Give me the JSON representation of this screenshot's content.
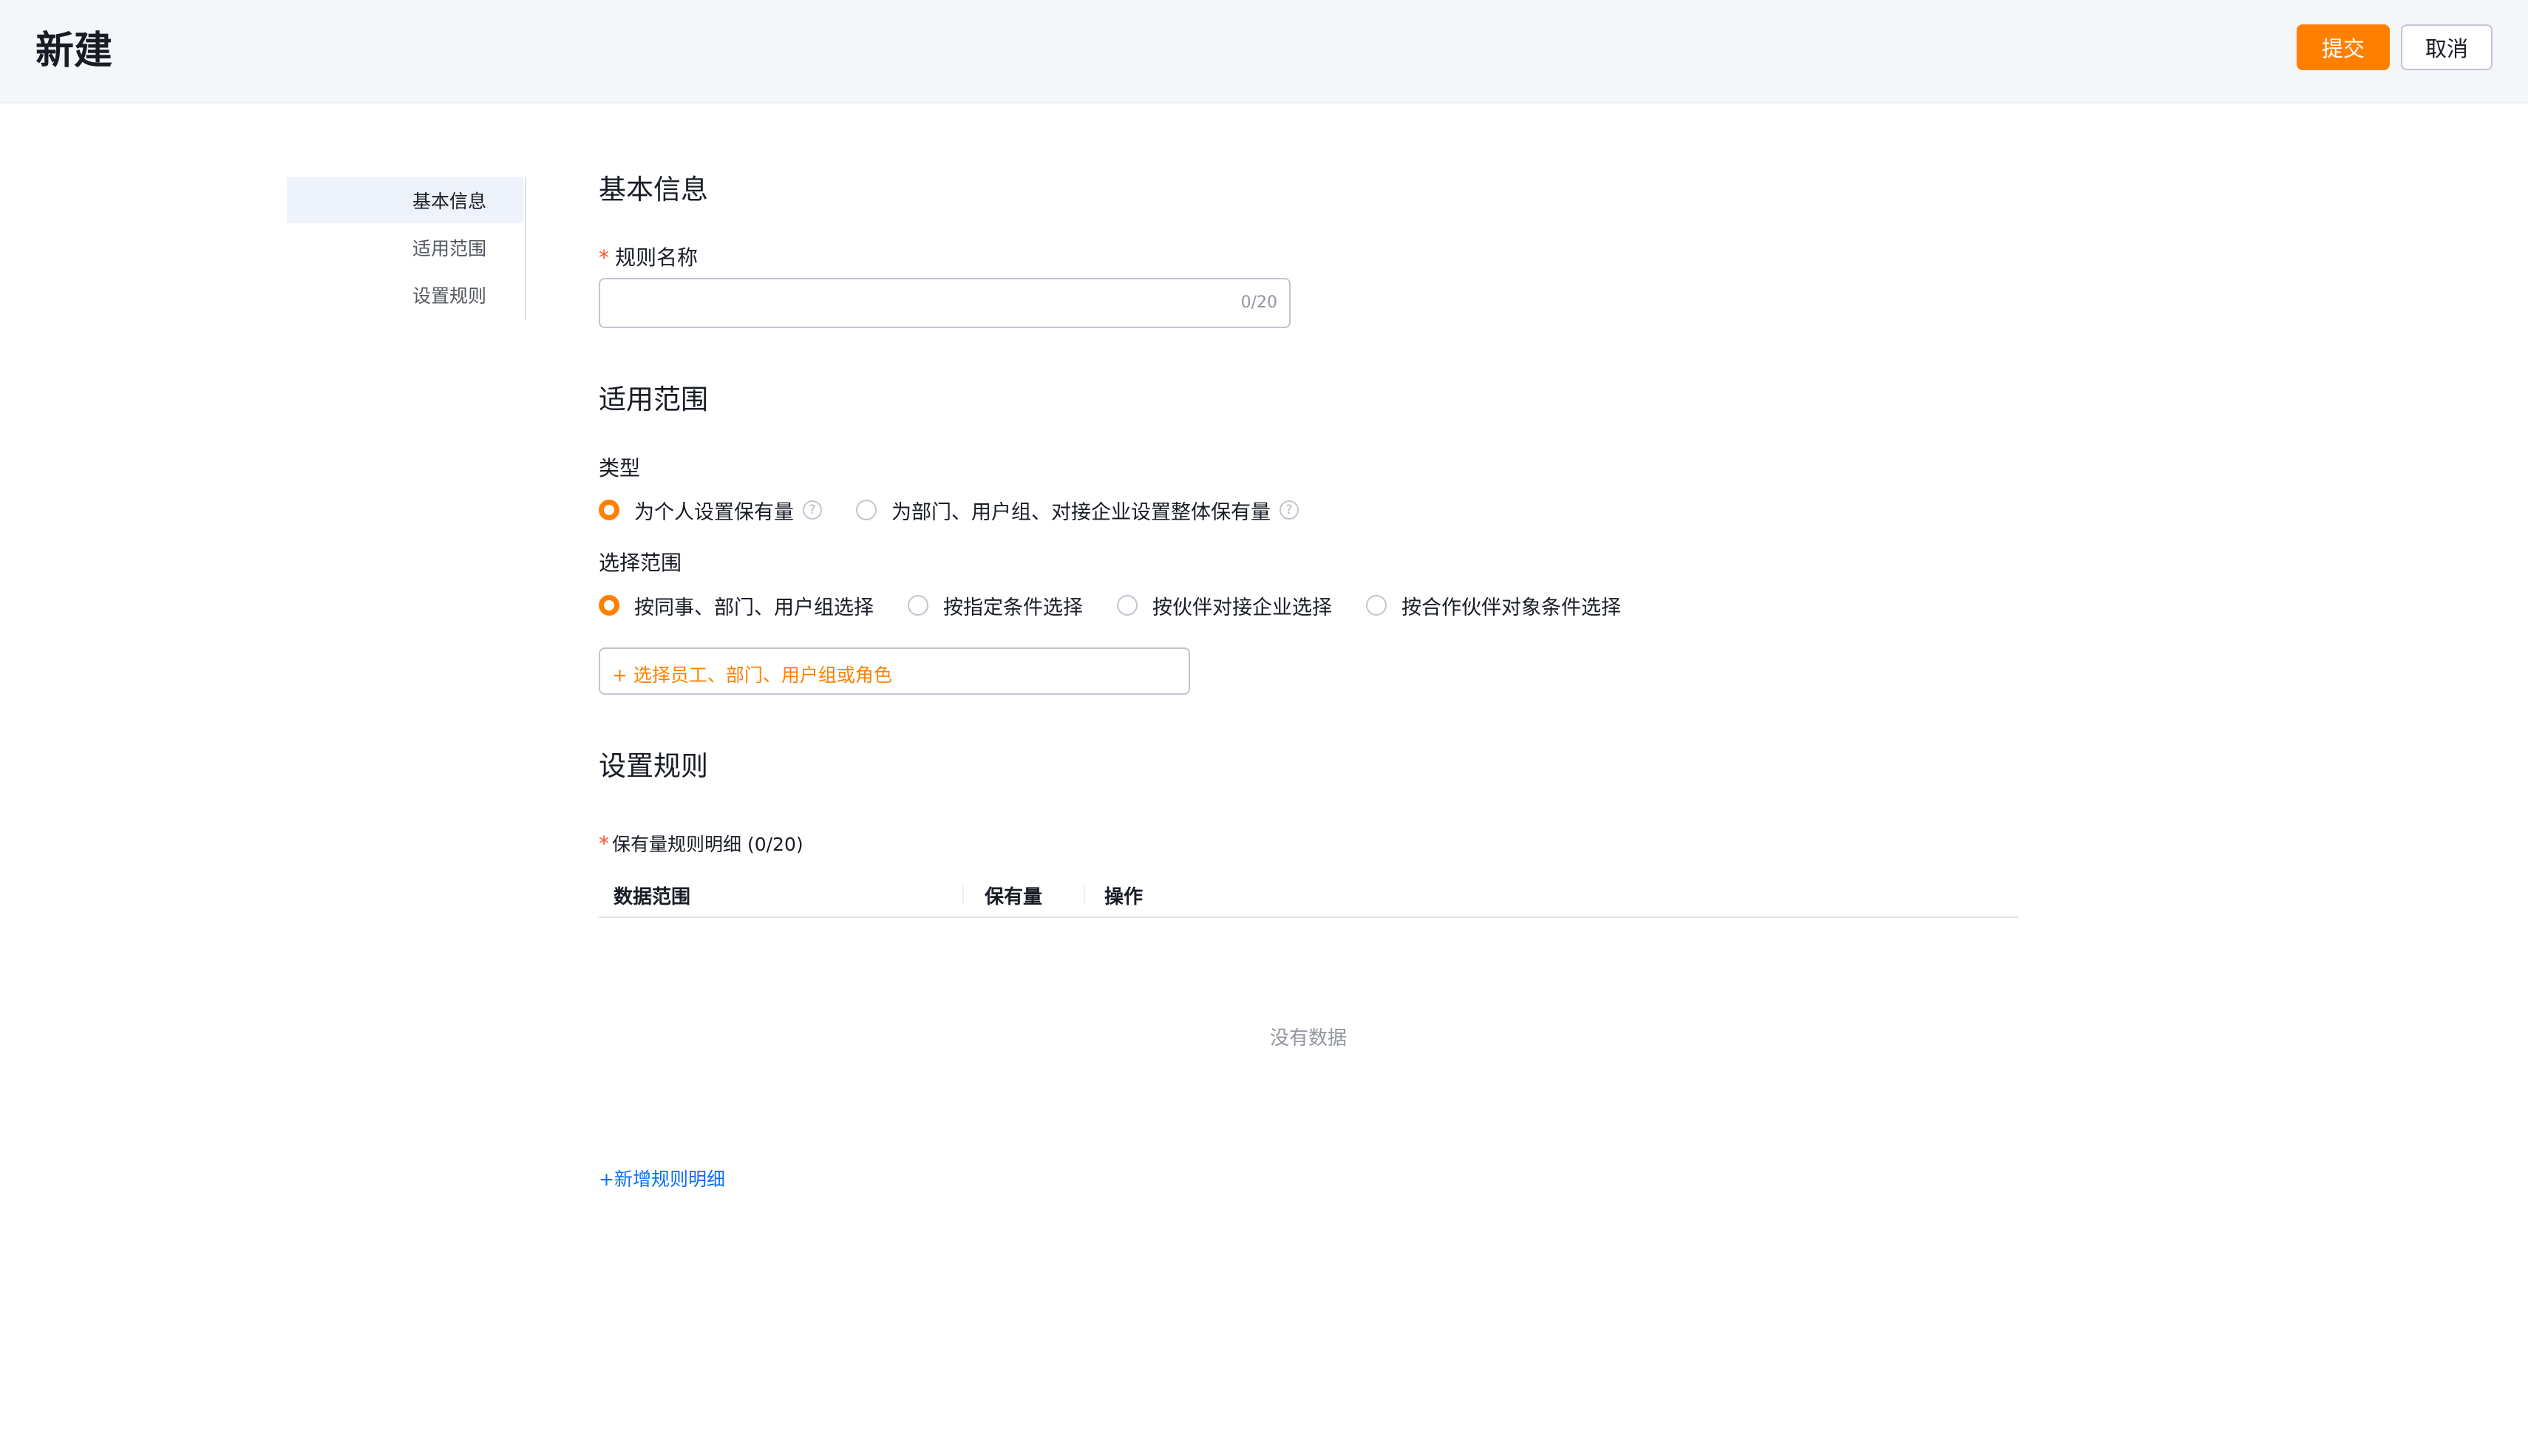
{
  "header": {
    "title": "新建",
    "submit_label": "提交",
    "cancel_label": "取消"
  },
  "colors": {
    "accent": "#ff8000",
    "link": "#0c6cff",
    "required": "#ff522a"
  },
  "sidenav": {
    "items": [
      {
        "label": "基本信息",
        "active": true
      },
      {
        "label": "适用范围",
        "active": false
      },
      {
        "label": "设置规则",
        "active": false
      }
    ]
  },
  "basic": {
    "title": "基本信息",
    "name_label": "规则名称",
    "name_value": "",
    "name_counter": "0/20"
  },
  "scope": {
    "title": "适用范围",
    "type_label": "类型",
    "type_options": [
      {
        "label": "为个人设置保有量",
        "checked": true,
        "help_icon": "question-circle-icon"
      },
      {
        "label": "为部门、用户组、对接企业设置整体保有量",
        "checked": false,
        "help_icon": "question-circle-icon"
      }
    ],
    "range_label": "选择范围",
    "range_options": [
      {
        "label": "按同事、部门、用户组选择",
        "checked": true
      },
      {
        "label": "按指定条件选择",
        "checked": false
      },
      {
        "label": "按伙伴对接企业选择",
        "checked": false
      },
      {
        "label": "按合作伙伴对象条件选择",
        "checked": false
      }
    ],
    "select_placeholder": "+ 选择员工、部门、用户组或角色"
  },
  "rules": {
    "title": "设置规则",
    "detail_label": "保有量规则明细",
    "detail_count": "(0/20)",
    "columns": [
      "数据范围",
      "保有量",
      "操作"
    ],
    "empty_text": "没有数据",
    "add_label": "+新增规则明细"
  }
}
